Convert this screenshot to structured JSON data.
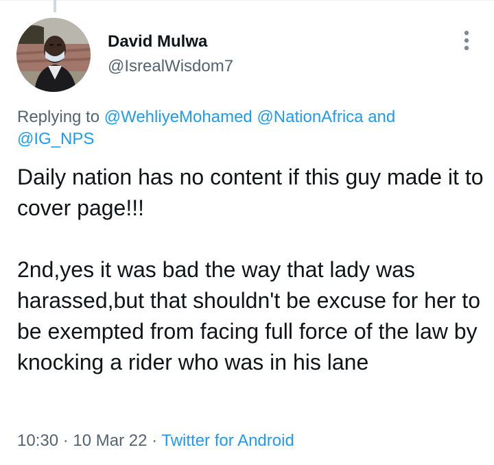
{
  "tweet": {
    "author": {
      "display_name": "David Mulwa",
      "handle": "@IsrealWisdom7"
    },
    "replying": {
      "prefix": "Replying to",
      "mentions": [
        "@WehliyeMohamed",
        "@NationAfrica"
      ],
      "conjunction": "and",
      "last_mention": "@IG_NPS"
    },
    "text": "Daily nation has no content if this guy made it to cover page!!!\n\n2nd,yes it was bad the way that lady was harassed,but that shouldn't be excuse for her to be exempted from facing full force of the law by knocking a rider who was in his lane",
    "time": "10:30",
    "date": "10 Mar 22",
    "separator": "·",
    "source": "Twitter for Android"
  },
  "icons": {
    "more": "more-vertical-icon"
  },
  "colors": {
    "link": "#1d9bf0",
    "secondary_text": "#536471",
    "primary_text": "#0f1419",
    "thread_line": "#cfd9de"
  }
}
